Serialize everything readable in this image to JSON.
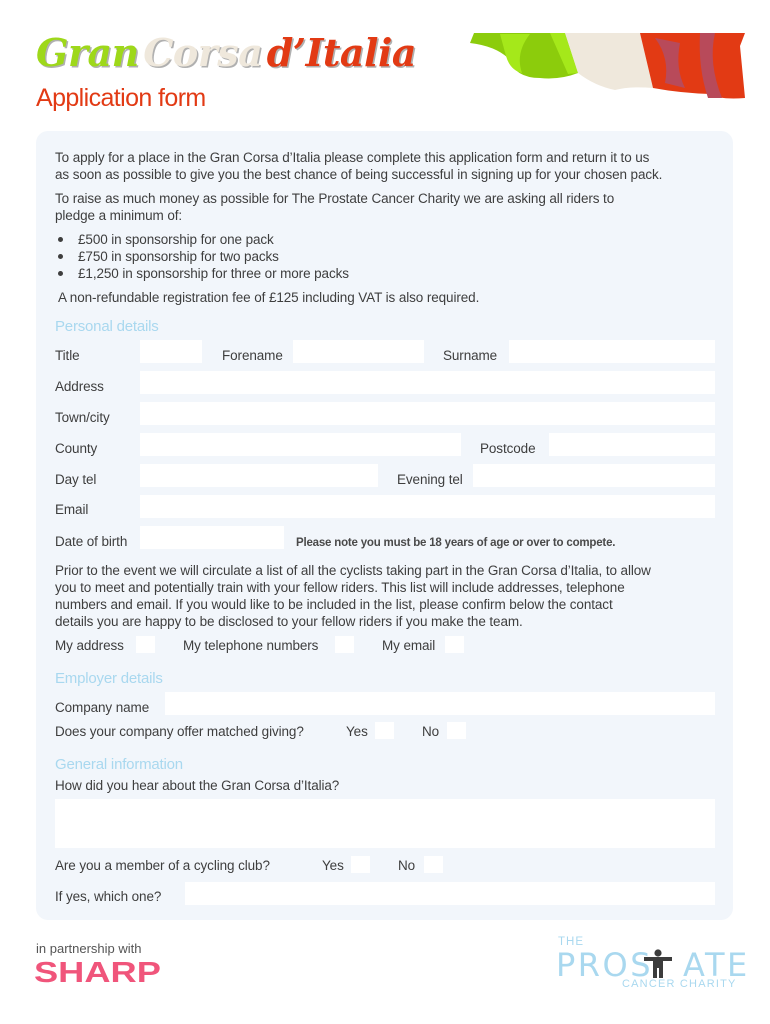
{
  "header": {
    "title_part1": "Gran",
    "title_part2": "Corsa",
    "title_part3": "d’Italia",
    "subtitle": "Application form",
    "colors": {
      "green": "#9ed81a",
      "cream": "#efe8dc",
      "red": "#e23a14"
    }
  },
  "intro": {
    "para1_line1": "To apply for a place in the Gran Corsa d’Italia please complete this application form and return it to us",
    "para1_line2": "as soon as possible to give you the best chance of being successful in signing up for your chosen pack.",
    "para2_line1": "To raise as much money as possible for The Prostate Cancer Charity we are asking all riders to",
    "para2_line2": "pledge a minimum of:",
    "bullets": [
      "£500 in sponsorship for one pack",
      "£750 in sponsorship for two packs",
      "£1,250 in sponsorship for three or more packs"
    ],
    "fee_note": "A non-refundable registration fee of £125 including VAT is also required."
  },
  "personal": {
    "heading": "Personal details",
    "title_label": "Title",
    "forename_label": "Forename",
    "surname_label": "Surname",
    "address_label": "Address",
    "town_label": "Town/city",
    "county_label": "County",
    "postcode_label": "Postcode",
    "daytel_label": "Day tel",
    "eveningtel_label": "Evening tel",
    "email_label": "Email",
    "dob_label": "Date of birth",
    "age_note": "Please note you must be 18 years of age or over to compete."
  },
  "disclosure": {
    "line1": "Prior to the event we will circulate a list of all the cyclists taking part in the Gran Corsa d’Italia, to allow",
    "line2": "you to meet and potentially train with your fellow riders. This list will include addresses, telephone",
    "line3": "numbers and email. If you would like to be included in the list, please confirm below the contact",
    "line4": "details you are happy to be disclosed to your fellow riders if you make the team.",
    "address_label": "My address",
    "phone_label": "My telephone numbers",
    "email_label": "My email"
  },
  "employer": {
    "heading": "Employer details",
    "company_label": "Company name",
    "matched_question": "Does your company offer matched giving?",
    "yes_label": "Yes",
    "no_label": "No"
  },
  "general": {
    "heading": "General information",
    "hear_question": "How did you hear about the Gran Corsa d’Italia?",
    "club_question": "Are you a member of a cycling club?",
    "yes_label": "Yes",
    "no_label": "No",
    "which_label": "If yes, which one?"
  },
  "footer": {
    "partnership": "in partnership with",
    "sharp_logo": "SHARP",
    "charity_the": "THE",
    "charity_main_left": "PROS",
    "charity_main_right": "ATE",
    "charity_sub": "CANCER CHARITY",
    "charity_icon": "person-figure-icon"
  }
}
